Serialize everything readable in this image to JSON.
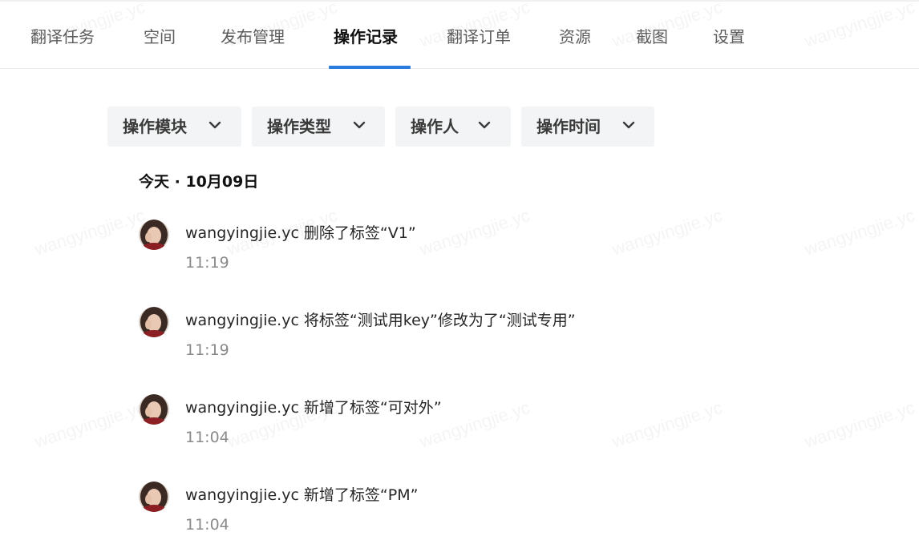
{
  "tabs": [
    {
      "label": "翻译任务"
    },
    {
      "label": "空间"
    },
    {
      "label": "发布管理"
    },
    {
      "label": "操作记录"
    },
    {
      "label": "翻译订单"
    },
    {
      "label": "资源"
    },
    {
      "label": "截图"
    },
    {
      "label": "设置"
    }
  ],
  "active_tab": "操作记录",
  "accent_color": "#2b7bde",
  "filters": [
    {
      "label": "操作模块",
      "icon": "chevron-down-icon"
    },
    {
      "label": "操作类型",
      "icon": "chevron-down-icon"
    },
    {
      "label": "操作人",
      "icon": "chevron-down-icon"
    },
    {
      "label": "操作时间",
      "icon": "chevron-down-icon"
    }
  ],
  "date_heading": "今天 · 10月09日",
  "watermark": "wangyingjie.yc",
  "entries": [
    {
      "text": "wangyingjie.yc 删除了标签“V1”",
      "time": "11:19",
      "icon": "user-avatar"
    },
    {
      "text": "wangyingjie.yc 将标签“测试用key”修改为了“测试专用”",
      "time": "11:19",
      "icon": "user-avatar"
    },
    {
      "text": "wangyingjie.yc 新增了标签“可对外”",
      "time": "11:04",
      "icon": "user-avatar"
    },
    {
      "text": "wangyingjie.yc 新增了标签“PM”",
      "time": "11:04",
      "icon": "user-avatar"
    }
  ]
}
